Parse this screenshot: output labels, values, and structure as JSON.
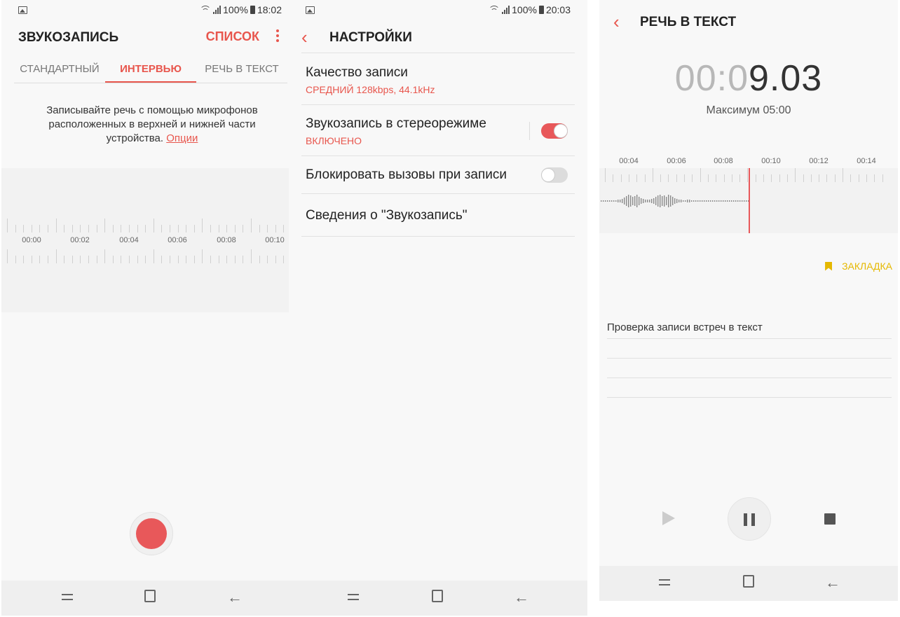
{
  "panel1": {
    "status": {
      "battery": "100%",
      "time": "18:02"
    },
    "title": "ЗВУКОЗАПИСЬ",
    "list_label": "СПИСОК",
    "tabs": [
      "СТАНДАРТНЫЙ",
      "ИНТЕРВЬЮ",
      "РЕЧЬ В ТЕКСТ"
    ],
    "active_tab": "ИНТЕРВЬЮ",
    "description_line1": "Записывайте речь с помощью микрофонов",
    "description_line2": "расположенных в верхней и нижней части",
    "description_line3": "устройства.",
    "options_link": "Опции",
    "time_labels": [
      "00:00",
      "00:02",
      "00:04",
      "00:06",
      "00:08",
      "00:10"
    ]
  },
  "panel2": {
    "status": {
      "battery": "100%",
      "time": "20:03"
    },
    "title": "НАСТРОЙКИ",
    "settings": [
      {
        "title": "Качество записи",
        "subtitle": "СРЕДНИЙ 128kbps, 44.1kHz"
      },
      {
        "title": "Звукозапись в стереорежиме",
        "subtitle": "ВКЛЮЧЕНО",
        "toggle": true
      },
      {
        "title": "Блокировать вызовы при записи",
        "toggle": false
      },
      {
        "title": "Сведения о \"Звукозапись\""
      }
    ]
  },
  "panel3": {
    "title": "РЕЧЬ В ТЕКСТ",
    "timer_dim": "00:0",
    "timer_bold": "9.03",
    "max_label": "Максимум 05:00",
    "time_labels": [
      "00:04",
      "00:06",
      "00:08",
      "00:10",
      "00:12",
      "00:14"
    ],
    "bookmark_label": "ЗАКЛАДКА",
    "transcript_lines": [
      "Проверка записи встреч в текст",
      "",
      "",
      ""
    ]
  },
  "colors": {
    "accent": "#e8564d",
    "record": "#e8585a",
    "bookmark": "#e5b800"
  }
}
